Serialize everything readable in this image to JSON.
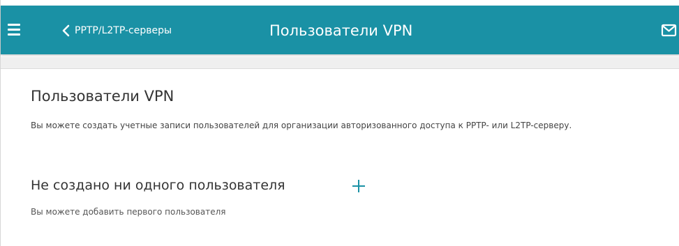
{
  "header": {
    "back_label": "PPTP/L2TP-серверы",
    "title": "Пользователи VPN",
    "icons": {
      "menu": "hamburger-menu-icon",
      "back": "chevron-left-icon",
      "mail": "mail-icon"
    },
    "colors": {
      "bar": "#1a91a5",
      "text": "#ffffff"
    }
  },
  "section": {
    "title": "Пользователи VPN",
    "description": "Вы можете создать учетные записи пользователей для организации авторизованного доступа к PPTP- или L2TP-серверу."
  },
  "empty_state": {
    "title": "Не создано ни одного пользователя",
    "description": "Вы можете добавить первого пользователя",
    "add_icon": "plus-icon",
    "accent": "#1a91a5"
  }
}
